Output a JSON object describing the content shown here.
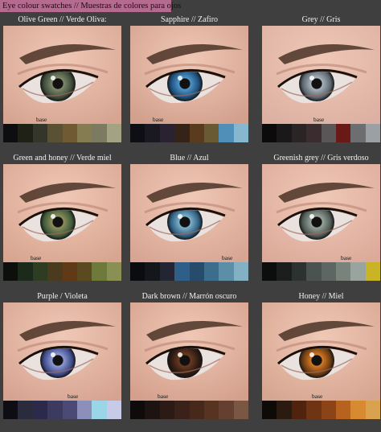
{
  "title": "Eye colour swatches // Muestras de colores para ojos",
  "base_label": "base",
  "swatches": [
    {
      "label": "Olive Green // Verde Oliva:",
      "iris_outer": "#3d4a3a",
      "iris_inner": "#7f8a6a",
      "skin": "#d6a592",
      "colors": [
        "#0d0e10",
        "#1f2117",
        "#34362a",
        "#5a5033",
        "#6f5a33",
        "#857c52",
        "#7c7a60",
        "#a3a384"
      ]
    },
    {
      "label": "Sapphire // Zafiro",
      "iris_outer": "#1d4e7a",
      "iris_inner": "#4f96c8",
      "skin": "#d2a08d",
      "colors": [
        "#0d0f14",
        "#1a1820",
        "#2a2230",
        "#342316",
        "#5a3b1e",
        "#6a5a33",
        "#4f8fb8",
        "#87b7cf"
      ]
    },
    {
      "label": "Grey // Gris",
      "iris_outer": "#5c6670",
      "iris_inner": "#a9b3bb",
      "skin": "#dcb0a2",
      "colors": [
        "#0b0b0c",
        "#1a1818",
        "#2a2425",
        "#3b2d2f",
        "#5a5557",
        "#6a1a16",
        "#6c6e70",
        "#9aa0a4"
      ]
    },
    {
      "label": "Green and honey // Verde miel",
      "iris_outer": "#3e5a3a",
      "iris_inner": "#8f8f5c",
      "skin": "#d8a590",
      "colors": [
        "#0c0f0b",
        "#1c2a1b",
        "#2e3d22",
        "#4a3a1e",
        "#603a17",
        "#5b4a1f",
        "#6e7a3a",
        "#8a8f54"
      ]
    },
    {
      "label": "Blue // Azul",
      "iris_outer": "#2e5f80",
      "iris_inner": "#7fb1cc",
      "skin": "#d8a593",
      "colors": [
        "#0b0c10",
        "#15161c",
        "#232632",
        "#2f5e88",
        "#274b6a",
        "#3d6d8c",
        "#5d8ea8",
        "#84b0c4"
      ]
    },
    {
      "label": "Greenish grey // Gris verdoso",
      "iris_outer": "#4f5a55",
      "iris_inner": "#98a39c",
      "skin": "#dcaa9a",
      "colors": [
        "#0c0d0d",
        "#1c1e1e",
        "#2b3230",
        "#4a5350",
        "#5d6663",
        "#7a827c",
        "#9aa49e",
        "#c8b425"
      ]
    },
    {
      "label": "Purple / Violeta",
      "iris_outer": "#3e4a8a",
      "iris_inner": "#8d9ad2",
      "skin": "#d7a391",
      "colors": [
        "#0d0d13",
        "#2a2c3e",
        "#2c2a4a",
        "#3d3a60",
        "#4a4a74",
        "#8b8fba",
        "#9ad6e8",
        "#c7cbe8"
      ]
    },
    {
      "label": "Dark brown // Marrón oscuro",
      "iris_outer": "#2b1a12",
      "iris_inner": "#6a3a22",
      "skin": "#d4a08c",
      "colors": [
        "#0e0b0a",
        "#1d1411",
        "#2c1a14",
        "#3a221a",
        "#47291c",
        "#573322",
        "#654030",
        "#7a5742"
      ]
    },
    {
      "label": "Honey // Miel",
      "iris_outer": "#6a3a10",
      "iris_inner": "#d47a26",
      "skin": "#d6a690",
      "colors": [
        "#0e0a08",
        "#2a1a10",
        "#51230f",
        "#6e3414",
        "#8a4417",
        "#b8621f",
        "#d88a30",
        "#d9a24f"
      ]
    }
  ]
}
